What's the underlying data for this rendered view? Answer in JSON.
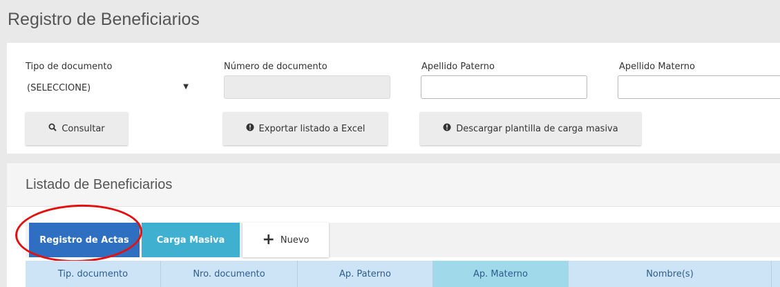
{
  "page": {
    "title": "Registro de Beneficiarios"
  },
  "filters": {
    "tipo_label": "Tipo de documento",
    "tipo_value": "(SELECCIONE)",
    "numero_label": "Número de documento",
    "numero_value": "",
    "paterno_label": "Apellido Paterno",
    "paterno_value": "",
    "materno_label": "Apellido Materno",
    "materno_value": ""
  },
  "buttons": {
    "consultar": "Consultar",
    "exportar": "Exportar listado a Excel",
    "descargar": "Descargar plantilla de carga masiva"
  },
  "icons": {
    "search": "search-icon",
    "download": "download-circle-icon",
    "plus": "plus-icon"
  },
  "list": {
    "title": "Listado de Beneficiarios",
    "tabs": [
      "Registro de Actas",
      "Carga Masiva",
      "Nuevo"
    ],
    "columns": [
      "Tip. documento",
      "Nro. documento",
      "Ap. Paterno",
      "Ap. Materno",
      "Nombre(s)"
    ]
  },
  "colors": {
    "primary_tab": "#2e6fc2",
    "secondary_tab": "#40b0d0",
    "header_bg": "#cde4f7",
    "active_column": "#9fd9ea",
    "annotation": "#e31010"
  }
}
